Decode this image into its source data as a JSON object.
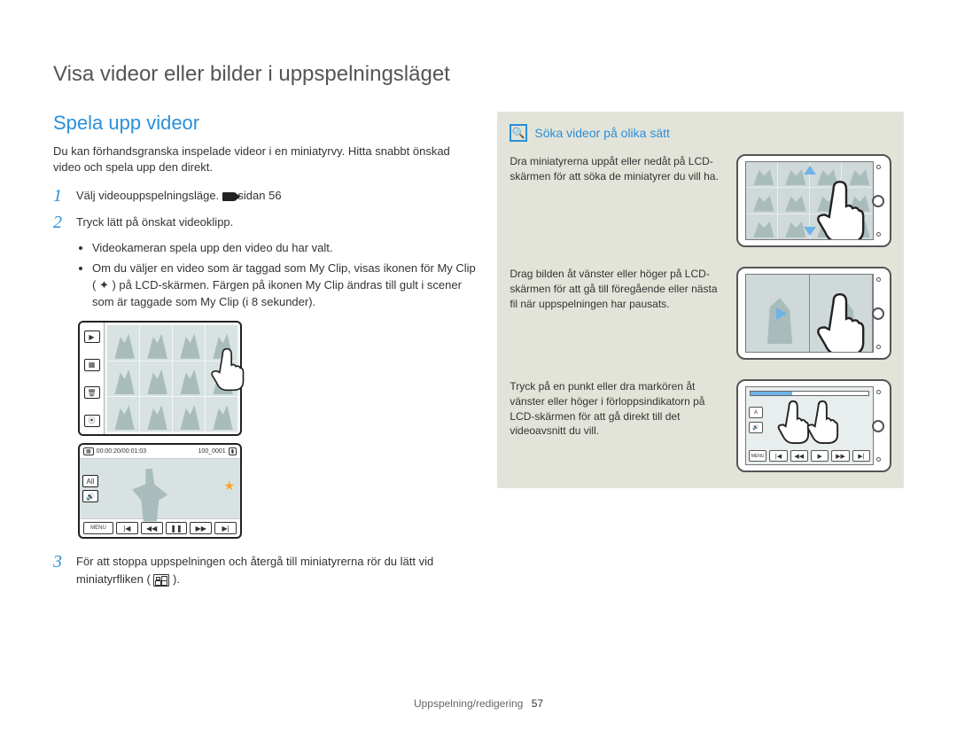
{
  "chapter_title": "Visa videor eller bilder i uppspelningsläget",
  "section_title": "Spela upp videor",
  "intro": "Du kan förhandsgranska inspelade videor i en miniatyrvy. Hitta snabbt önskad video och spela upp den direkt.",
  "steps": {
    "s1": {
      "num": "1",
      "text_a": "Välj videouppspelningsläge. ",
      "text_b": "sidan 56"
    },
    "s2": {
      "num": "2",
      "text": "Tryck lätt på önskat videoklipp."
    },
    "s3": {
      "num": "3",
      "text_a": "För att stoppa uppspelningen och återgå till miniatyrerna rör du lätt vid miniatyrfliken ( ",
      "text_b": " )."
    }
  },
  "bullets": {
    "b1": "Videokameran spela upp den video du har valt.",
    "b2": "Om du väljer en video som är taggad som My Clip, visas ikonen för My Clip ( ✦ ) på LCD-skärmen. Färgen på ikonen My Clip ändras till gult i scener som är taggade som My Clip (i 8 sekunder)."
  },
  "player": {
    "time": "00:00:20/00:01:03",
    "counter": "100_0001",
    "menu": "MENU",
    "all": "All"
  },
  "callout": {
    "title": "Söka videor på olika sätt",
    "r1": "Dra miniatyrerna uppåt eller nedåt på LCD-skärmen för att söka de miniatyrer du vill ha.",
    "r2": "Drag bilden åt vänster eller höger på LCD-skärmen för att gå till föregående eller nästa fil när uppspelningen har pausats.",
    "r3": "Tryck på en punkt eller dra markören åt vänster eller höger i förloppsindikatorn på LCD-skärmen för att gå direkt till det videoavsnitt du vill."
  },
  "footer": {
    "section": "Uppspelning/redigering",
    "page": "57"
  }
}
